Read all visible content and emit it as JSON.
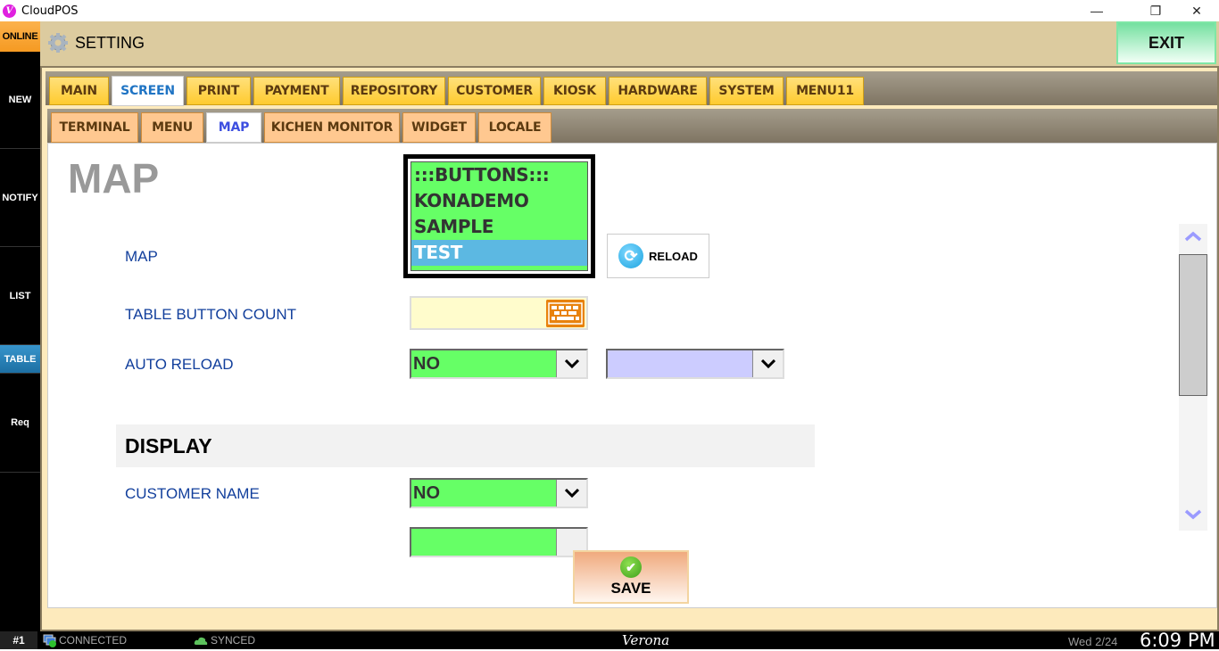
{
  "window": {
    "app_title": "CloudPOS",
    "logo_letter": "V",
    "minimize": "—",
    "restore": "❐",
    "close": "✕"
  },
  "sidebar": {
    "status": "ONLINE",
    "items": [
      {
        "label": "NEW"
      },
      {
        "label": "NOTIFY"
      },
      {
        "label": "LIST"
      },
      {
        "label": "TABLE",
        "active": true
      },
      {
        "label": "Req"
      }
    ]
  },
  "header": {
    "title": "SETTING",
    "exit_label": "EXIT"
  },
  "main_tabs": [
    {
      "label": "MAIN"
    },
    {
      "label": "SCREEN",
      "active": true
    },
    {
      "label": "PRINT"
    },
    {
      "label": "PAYMENT"
    },
    {
      "label": "REPOSITORY"
    },
    {
      "label": "CUSTOMER"
    },
    {
      "label": "KIOSK"
    },
    {
      "label": "HARDWARE"
    },
    {
      "label": "SYSTEM"
    },
    {
      "label": "MENU11"
    }
  ],
  "sub_tabs": [
    {
      "label": "TERMINAL"
    },
    {
      "label": "MENU"
    },
    {
      "label": "MAP",
      "active": true
    },
    {
      "label": "KICHEN MONITOR"
    },
    {
      "label": "WIDGET"
    },
    {
      "label": "LOCALE"
    }
  ],
  "page": {
    "heading": "MAP",
    "fields": {
      "map_label": "MAP",
      "map_options": [
        ":::BUTTONS:::",
        "KONADEMO",
        "SAMPLE",
        "TEST"
      ],
      "map_selected": "TEST",
      "reload_label": "RELOAD",
      "table_button_count_label": "TABLE BUTTON COUNT",
      "table_button_count_value": "",
      "auto_reload_label": "AUTO RELOAD",
      "auto_reload_value": "NO",
      "auto_reload_interval_value": ""
    },
    "display_section": {
      "title": "DISPLAY",
      "customer_name_label": "CUSTOMER NAME",
      "customer_name_value": "NO"
    },
    "save_label": "SAVE"
  },
  "statusbar": {
    "terminal": "#1",
    "connection": "CONNECTED",
    "sync": "SYNCED",
    "location": "Verona",
    "date": "Wed 2/24",
    "time": "6:09 PM"
  },
  "colors": {
    "online": "#f59a22",
    "tab_active_text": "#1f74c4",
    "subtab_active_text": "#3d4fe0",
    "select_green": "#66ff66",
    "select_lavender": "#ccccff",
    "list_selected": "#5cb8e2",
    "label_blue": "#123f9c"
  }
}
